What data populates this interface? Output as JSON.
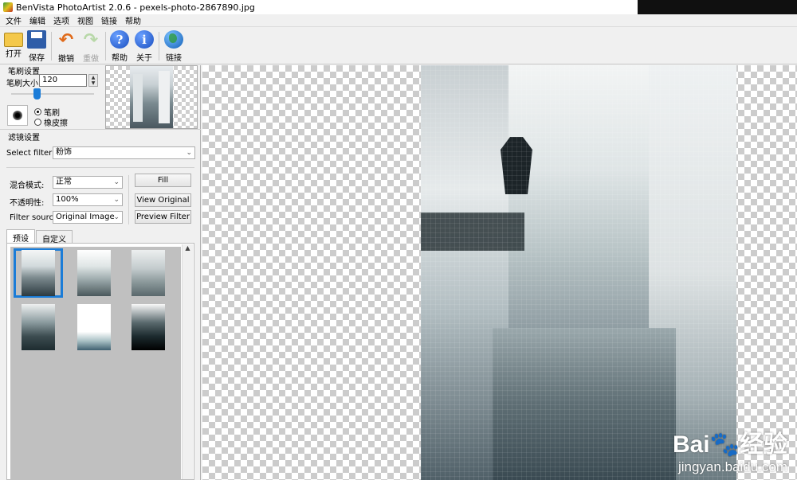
{
  "window": {
    "title": "BenVista PhotoArtist 2.0.6 - pexels-photo-2867890.jpg"
  },
  "menu": {
    "items": [
      "文件",
      "编辑",
      "选项",
      "视图",
      "链接",
      "帮助"
    ]
  },
  "toolbar": {
    "open_label": "打开",
    "save_label": "保存",
    "undo_label": "撤销",
    "redo_label": "重做",
    "help_label": "帮助",
    "about_label": "关于",
    "link_label": "链接",
    "help_glyph": "?",
    "about_glyph": "i"
  },
  "brush": {
    "group_label": "笔刷设置",
    "size_label": "笔刷大小:",
    "size_value": "120",
    "mode_brush": "笔刷",
    "mode_eraser": "橡皮擦",
    "selected_mode": "笔刷"
  },
  "filter": {
    "group_label": "滤镜设置",
    "select_label": "Select filter:",
    "select_value": "粉饰",
    "blend_label": "混合模式:",
    "blend_value": "正常",
    "opacity_label": "不透明性:",
    "opacity_value": "100%",
    "source_label": "Filter source:",
    "source_value": "Original Image",
    "fill_button": "Fill",
    "view_original_button": "View Original",
    "preview_filter_button": "Preview Filter"
  },
  "tabs": {
    "presets": "预设",
    "custom": "自定义",
    "active": "预设"
  },
  "presets": {
    "count": 6,
    "selected_index": 0
  },
  "watermark": {
    "logo": "Bai🐾经验",
    "url": "jingyan.baidu.com"
  },
  "icons": [
    "folder-icon",
    "floppy-disk-icon",
    "undo-arrow-icon",
    "redo-arrow-icon",
    "help-question-icon",
    "info-icon",
    "globe-icon"
  ]
}
